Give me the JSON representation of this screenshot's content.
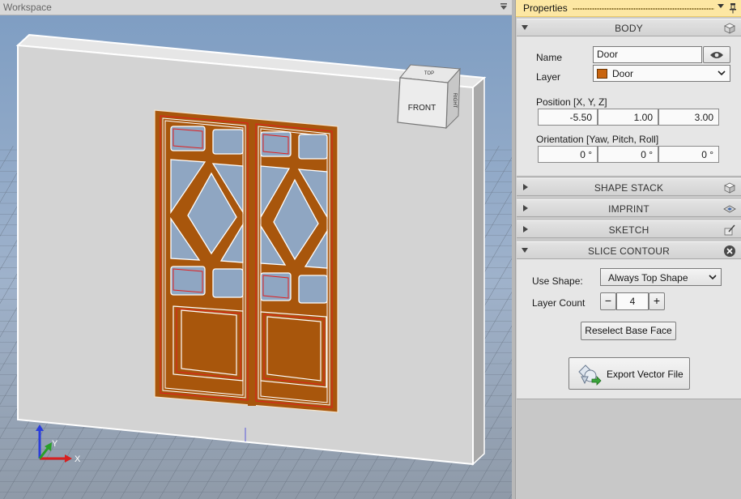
{
  "workspace": {
    "title": "Workspace",
    "view_cube": {
      "top": "TOP",
      "front": "FRONT",
      "right": "RIGHT"
    },
    "axes": {
      "x": "X",
      "y": "Y"
    }
  },
  "properties": {
    "title": "Properties",
    "body": {
      "header": "BODY",
      "name_label": "Name",
      "name_value": "Door",
      "layer_label": "Layer",
      "layer_value": "Door",
      "layer_color": "#c8640f",
      "position_label": "Position [X, Y, Z]",
      "position": [
        "-5.50",
        "1.00",
        "3.00"
      ],
      "orientation_label": "Orientation [Yaw, Pitch, Roll]",
      "orientation": [
        "0 °",
        "0 °",
        "0 °"
      ]
    },
    "shape_stack": {
      "header": "SHAPE STACK"
    },
    "imprint": {
      "header": "IMPRINT"
    },
    "sketch": {
      "header": "SKETCH"
    },
    "slice_contour": {
      "header": "SLICE CONTOUR",
      "use_shape_label": "Use Shape:",
      "use_shape_value": "Always Top Shape",
      "layer_count_label": "Layer Count",
      "layer_count_value": "4",
      "minus": "−",
      "plus": "+",
      "reselect_button": "Reselect Base Face",
      "export_button": "Export Vector File"
    }
  },
  "colors": {
    "accent": "#fde7a3",
    "door_wood": "#a8560c",
    "contour_red": "#e02020",
    "viewport_sky": "#7f9ec3",
    "wall": "#d4d4d4"
  }
}
